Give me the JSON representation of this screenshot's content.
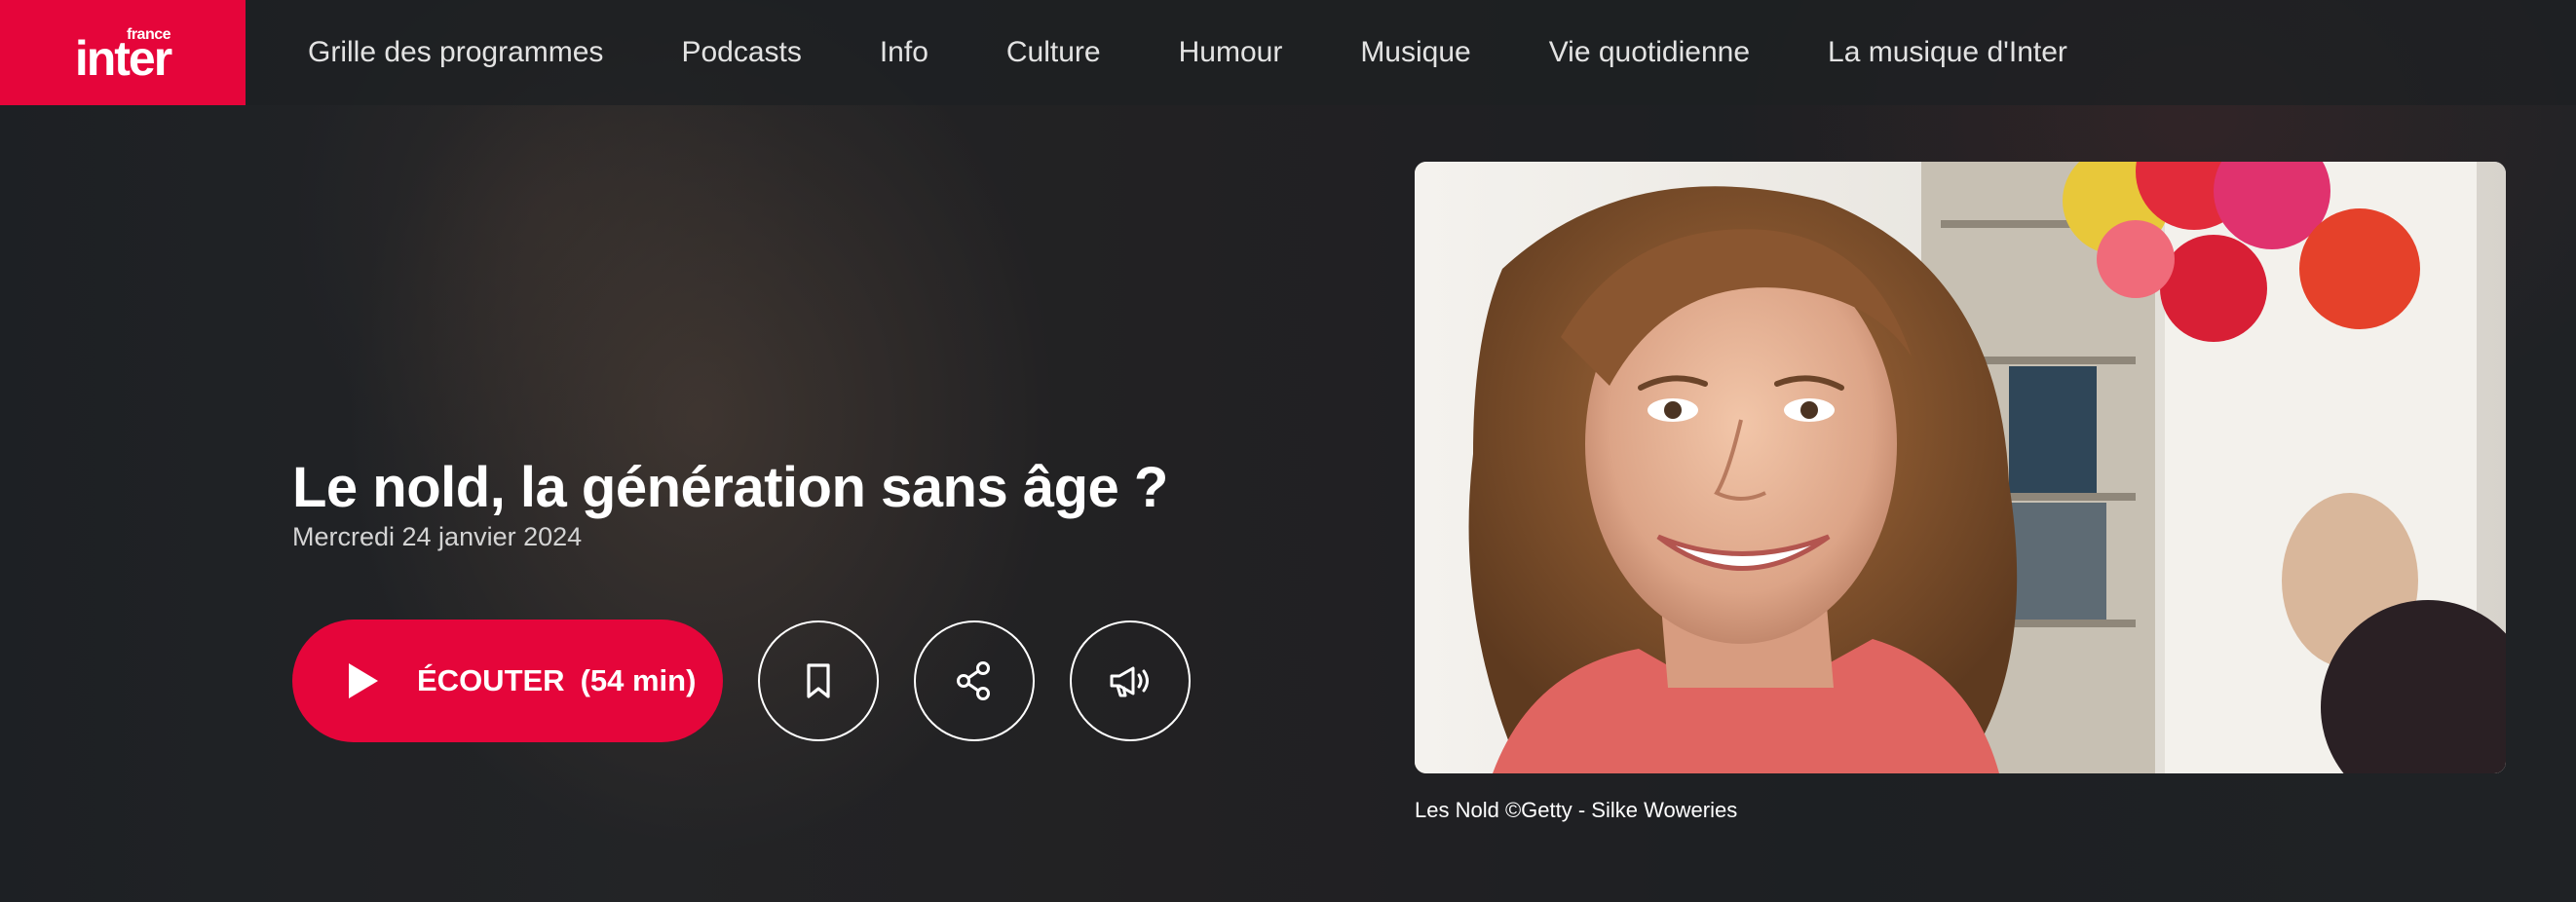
{
  "brand": {
    "name": "inter",
    "small": "france",
    "color": "#e5053a"
  },
  "nav": {
    "items": [
      {
        "label": "Grille des programmes"
      },
      {
        "label": "Podcasts"
      },
      {
        "label": "Info"
      },
      {
        "label": "Culture"
      },
      {
        "label": "Humour"
      },
      {
        "label": "Musique"
      },
      {
        "label": "Vie quotidienne"
      },
      {
        "label": "La musique d'Inter"
      }
    ]
  },
  "episode": {
    "title": "Le nold, la génération sans âge ?",
    "date": "Mercredi 24 janvier 2024",
    "listen_label": "ÉCOUTER",
    "duration": "(54 min)"
  },
  "actions": {
    "icons": [
      "play-icon",
      "bookmark-icon",
      "share-icon",
      "megaphone-icon"
    ]
  },
  "image": {
    "caption": "Les Nold ©Getty - Silke Woweries"
  }
}
